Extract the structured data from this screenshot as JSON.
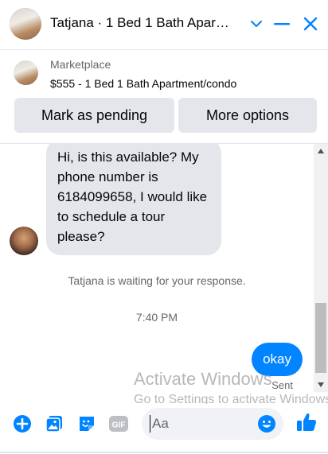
{
  "header": {
    "title": "Tatjana · 1 Bed 1 Bath Apartment/condo",
    "title_display": "Tatjana · 1 Bed 1 Bath Apar…",
    "icons": [
      "chevron-down-icon",
      "minimize-icon",
      "close-icon"
    ],
    "accent_color": "#0084ff"
  },
  "marketplace": {
    "label": "Marketplace",
    "listing": "$555 - 1 Bed 1 Bath Apartment/condo",
    "buttons": {
      "mark_pending": "Mark as pending",
      "more_options": "More options"
    }
  },
  "conversation": {
    "incoming_message": "Hi, is this available? My phone number is 6184099658, I would like to schedule a tour please?",
    "waiting_text": "Tatjana is waiting for your response.",
    "timestamp": "7:40 PM",
    "outgoing_message": "okay",
    "status": "Sent",
    "outgoing_color": "#0084ff"
  },
  "watermark": {
    "title": "Activate Windows",
    "subtitle": "Go to Settings to activate Windows."
  },
  "composer": {
    "placeholder": "Aa",
    "icons": [
      "add-icon",
      "photo-icon",
      "sticker-icon",
      "gif-icon",
      "emoji-icon",
      "like-icon"
    ],
    "gif_label": "GIF"
  }
}
